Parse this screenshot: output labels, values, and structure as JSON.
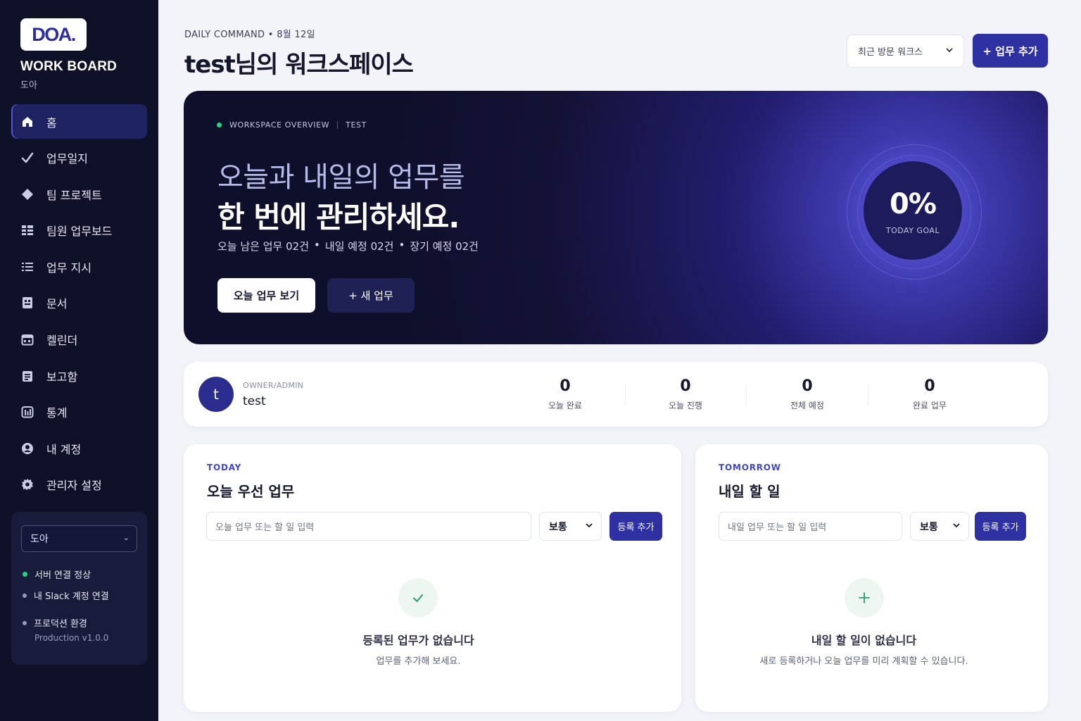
{
  "sidebar": {
    "logo": "DOA.",
    "brand_title": "WORK BOARD",
    "brand_sub": "도아",
    "items": [
      {
        "label": "홈",
        "icon": "home-icon",
        "active": true
      },
      {
        "label": "업무일지",
        "icon": "check-icon"
      },
      {
        "label": "팀 프로젝트",
        "icon": "diamond-icon"
      },
      {
        "label": "팀원 업무보드",
        "icon": "grid-icon"
      },
      {
        "label": "업무 지시",
        "icon": "list-icon"
      },
      {
        "label": "문서",
        "icon": "document-icon"
      },
      {
        "label": "켈린더",
        "icon": "calendar-icon"
      },
      {
        "label": "보고함",
        "icon": "report-icon"
      },
      {
        "label": "통계",
        "icon": "chart-icon"
      },
      {
        "label": "내 계정",
        "icon": "account-icon"
      },
      {
        "label": "관리자 설정",
        "icon": "settings-icon"
      }
    ],
    "workspace_select": "도아",
    "status": {
      "server": "서버 연결 정상",
      "slack": "내 Slack 계정 연결",
      "env": "프로덕션 환경",
      "version": "Production v1.0.0"
    },
    "colors": {
      "server_dot": "#2fcf86",
      "slack_dot": "#9a9dba",
      "env_dot": "#9a9dba"
    }
  },
  "header": {
    "eyebrow": "DAILY COMMAND • 8월 12일",
    "title": "test님의 워크스페이스",
    "recent_select": "최근 방문 워크스",
    "add_task": "+ 업무 추가"
  },
  "hero": {
    "tag": "WORKSPACE OVERVIEW",
    "tag2": "TEST",
    "line1": "오늘과 내일의 업무를",
    "line2": "한 번에 관리하세요.",
    "meta": [
      "오늘 남은 업무 02건",
      "내일 예정 02건",
      "장기 예정 02건"
    ],
    "btn_today": "오늘 업무 보기",
    "btn_new": "+ 새 업무",
    "goal_pct": "0%",
    "goal_label": "TODAY GOAL"
  },
  "stats": {
    "avatar": "t",
    "role": "OWNER/ADMIN",
    "name": "test",
    "items": [
      {
        "num": "0",
        "label": "오늘 완료"
      },
      {
        "num": "0",
        "label": "오늘 진행"
      },
      {
        "num": "0",
        "label": "전체 예정"
      },
      {
        "num": "0",
        "label": "완료 업무"
      }
    ]
  },
  "today": {
    "eyebrow": "TODAY",
    "title": "오늘 우선 업무",
    "placeholder": "오늘 업무 또는 할 일 입력",
    "priority": "보통",
    "register": "등록 추가",
    "empty_title": "등록된 업무가 없습니다",
    "empty_sub": "업무를 추가해 보세요."
  },
  "tomorrow": {
    "eyebrow": "TOMORROW",
    "title": "내일 할 일",
    "placeholder": "내일 업무 또는 할 일 입력",
    "priority": "보통",
    "register": "등록 추가",
    "empty_title": "내일 할 일이 없습니다",
    "empty_sub": "새로 등록하거나 오늘 업무를 미리 계획할 수 있습니다."
  }
}
